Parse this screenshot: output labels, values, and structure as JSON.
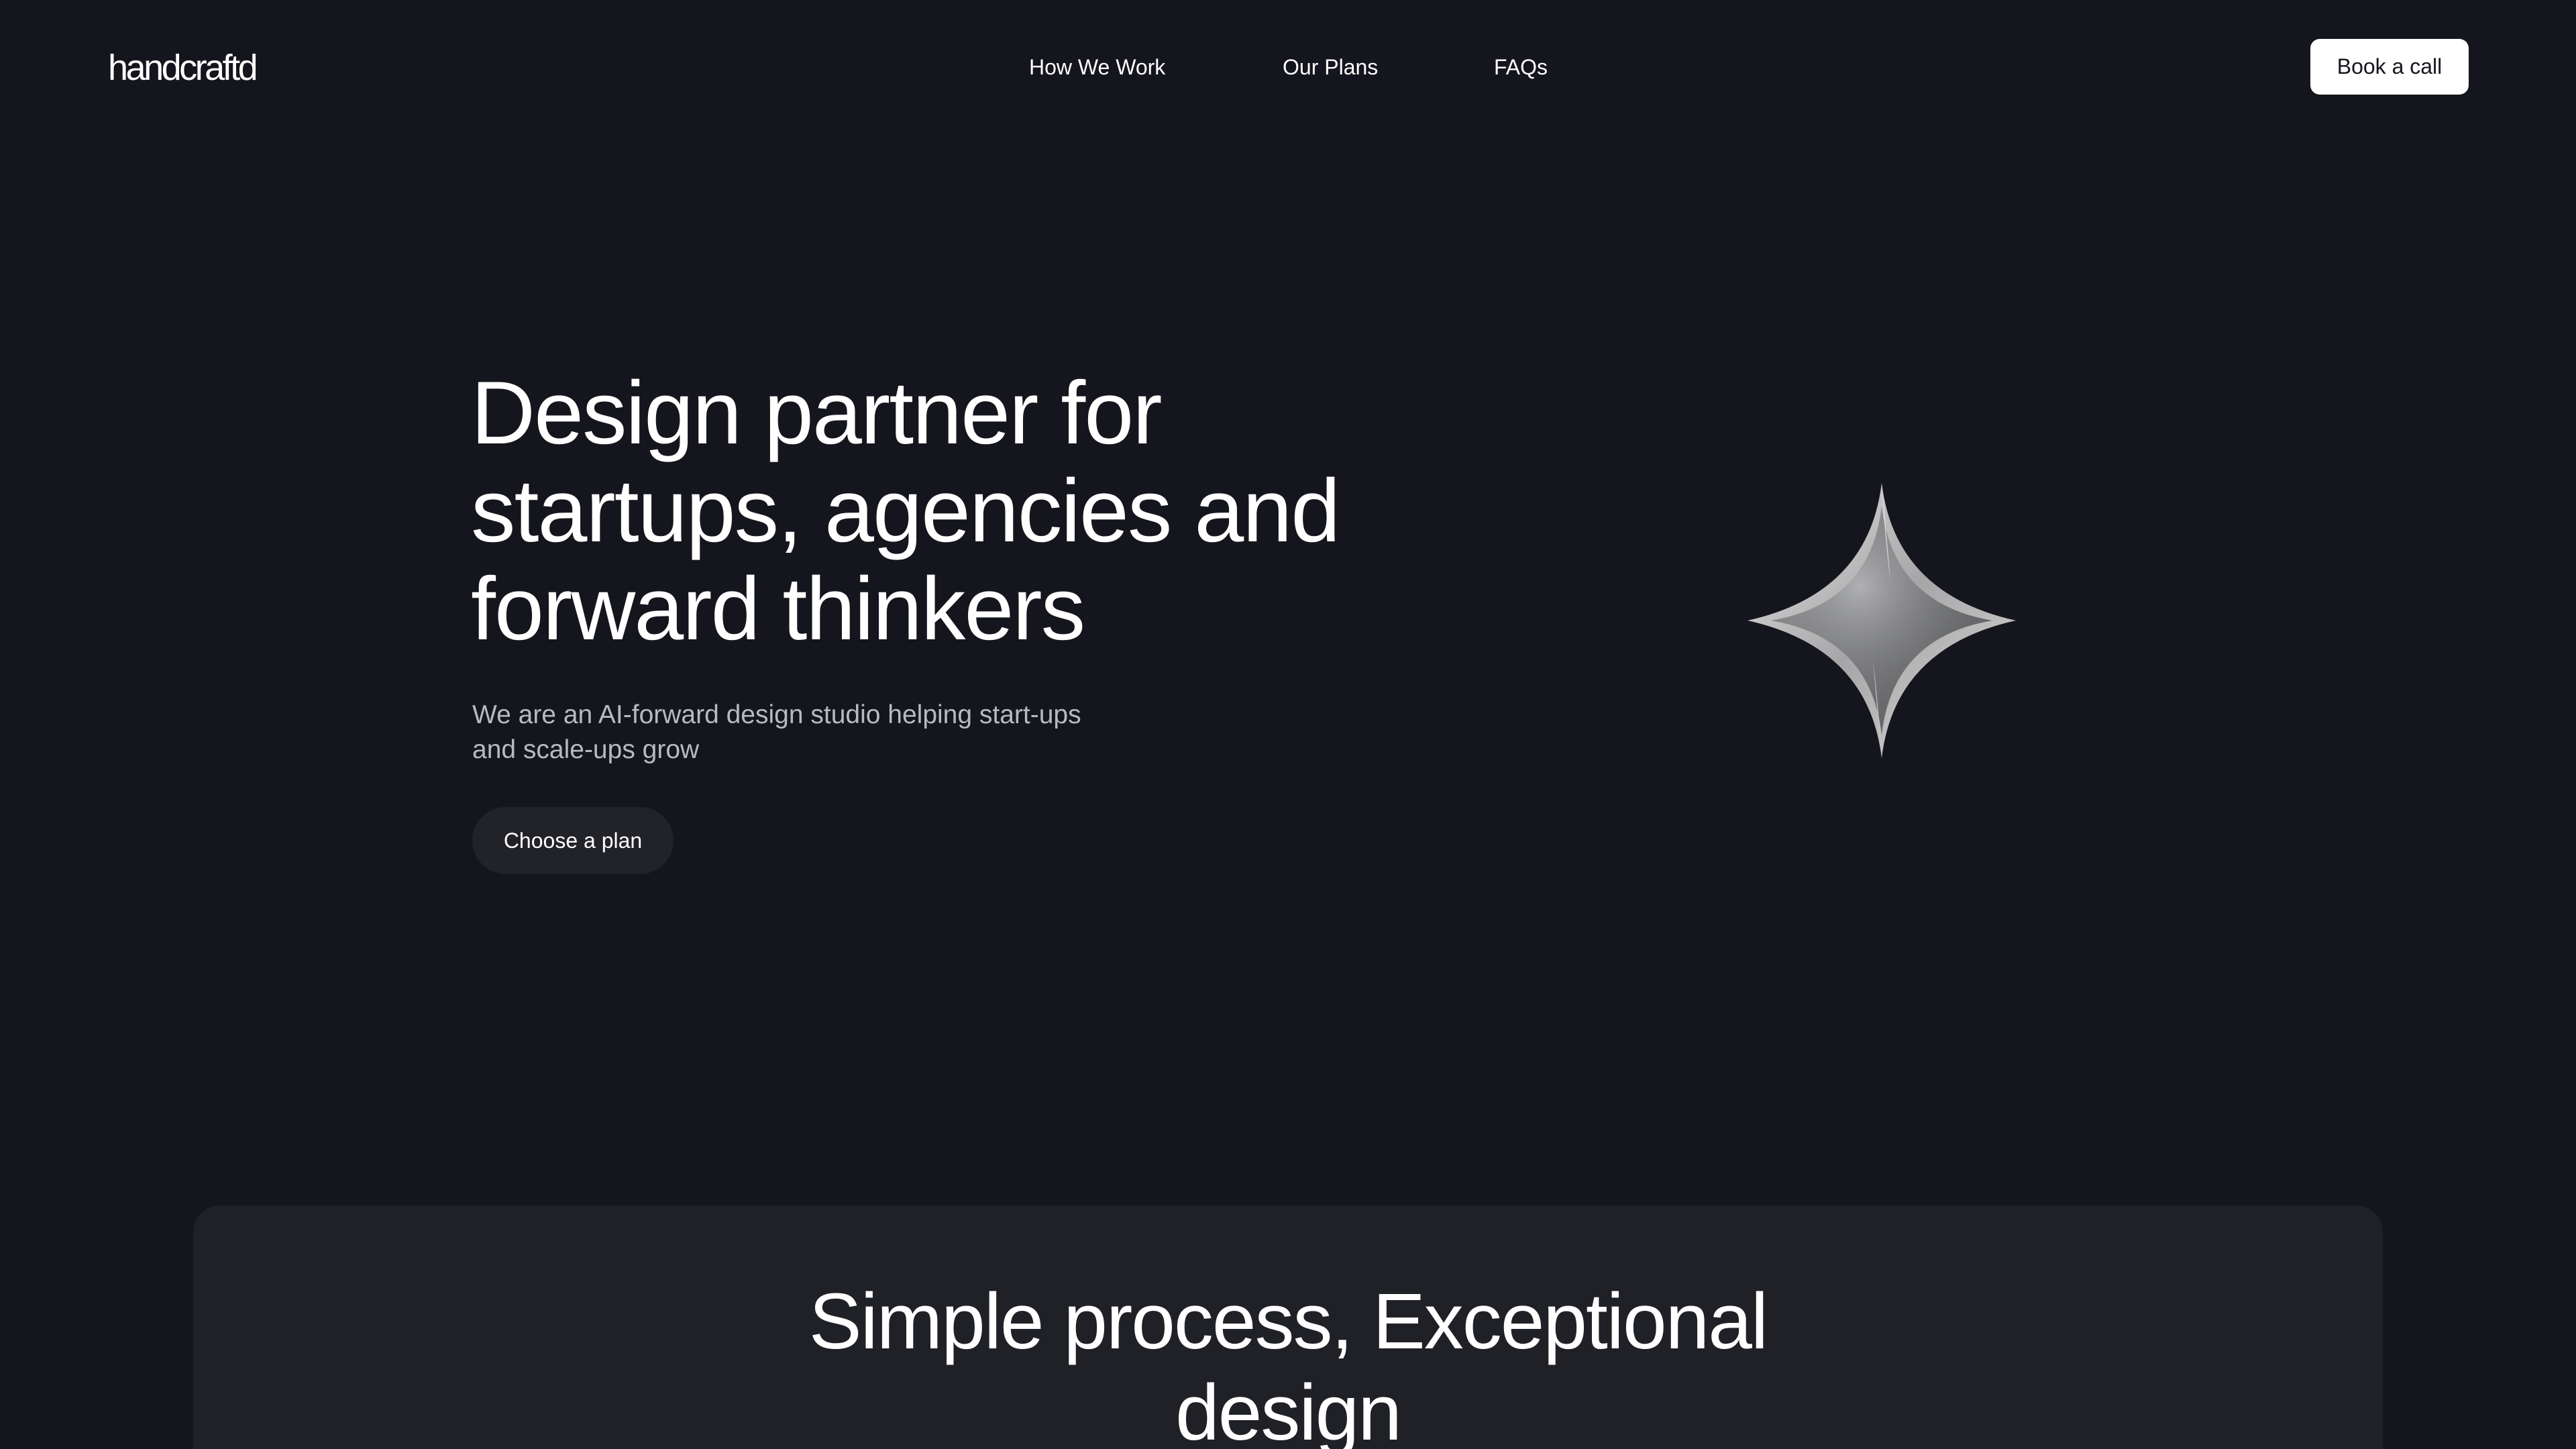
{
  "header": {
    "logo": "handcraftd",
    "nav": [
      {
        "label": "How We Work"
      },
      {
        "label": "Our Plans"
      },
      {
        "label": "FAQs"
      }
    ],
    "cta_label": "Book a call"
  },
  "hero": {
    "title_lines": [
      "Design partner for",
      "startups, agencies and",
      "forward thinkers"
    ],
    "subtitle_lines": [
      "We are an AI-forward design studio helping start-ups",
      "and scale-ups grow"
    ],
    "cta_label": "Choose a plan",
    "illustration": "sparkle-star-icon"
  },
  "process": {
    "title_lines": [
      "Simple process, Exceptional",
      "design"
    ]
  },
  "colors": {
    "background": "#15161d",
    "card": "#202126",
    "button_dark": "#222328",
    "text": "#ffffff",
    "muted_text": "#b9bac0"
  }
}
